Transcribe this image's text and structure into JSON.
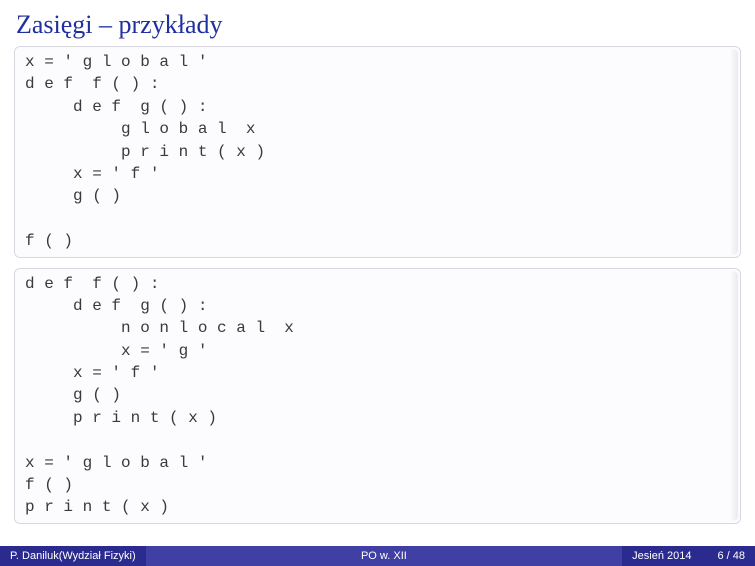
{
  "title": "Zasięgi – przykłady",
  "code_block_1": "x = ' g l o b a l '\nd e f  f ( ) :\n     d e f  g ( ) :\n          g l o b a l  x\n          p r i n t ( x )\n     x = ' f '\n     g ( )\n\nf ( )",
  "code_block_2": "d e f  f ( ) :\n     d e f  g ( ) :\n          n o n l o c a l  x\n          x = ' g '\n     x = ' f '\n     g ( )\n     p r i n t ( x )\n\nx = ' g l o b a l '\nf ( )\np r i n t ( x )",
  "footer": {
    "author": "P. Daniluk(Wydział Fizyki)",
    "middle": "PO w. XII",
    "date": "Jesień 2014",
    "page": "6 / 48"
  }
}
